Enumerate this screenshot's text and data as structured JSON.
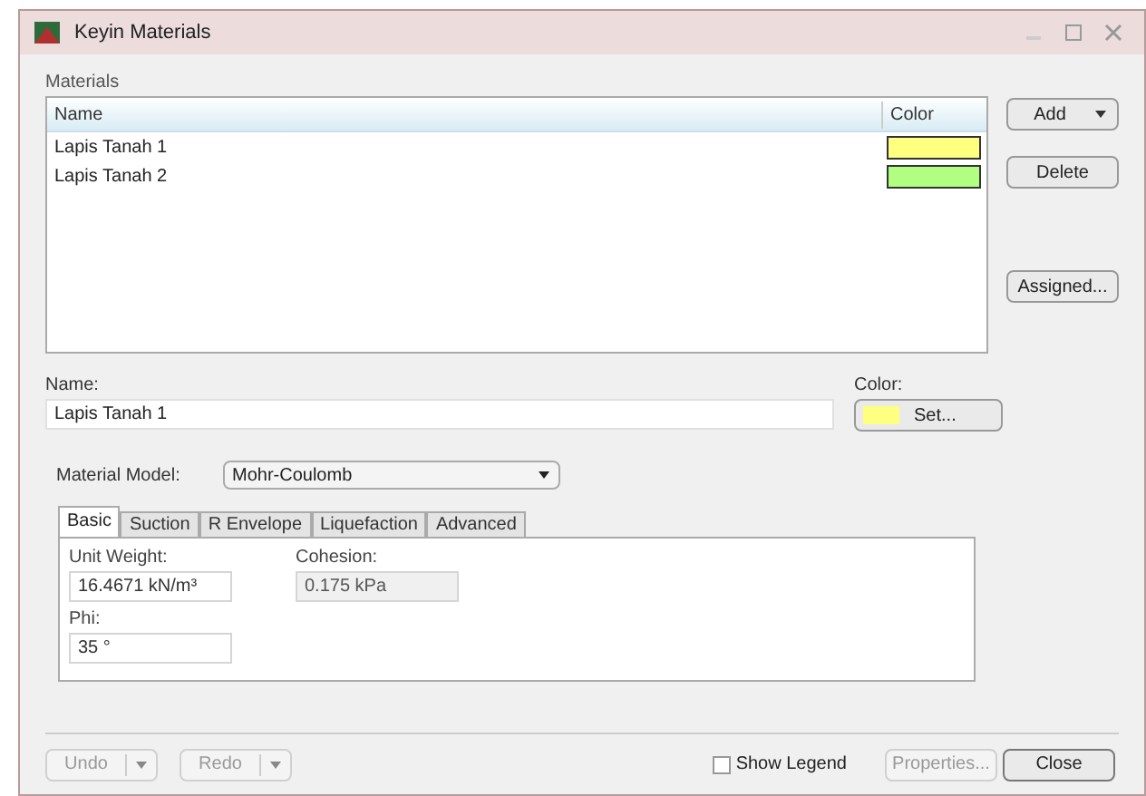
{
  "window": {
    "title": "Keyin Materials"
  },
  "materials": {
    "label": "Materials",
    "columns": [
      "Name",
      "Color"
    ],
    "rows": [
      {
        "name": "Lapis Tanah 1",
        "color": "#ffff80",
        "selected": false
      },
      {
        "name": "Lapis Tanah 2",
        "color": "#b0ff80",
        "selected": false
      }
    ]
  },
  "side_buttons": [
    {
      "label": "Add",
      "dropdown": true
    },
    {
      "label": "Delete",
      "dropdown": false
    },
    {
      "label": "Assigned...",
      "dropdown": false
    }
  ],
  "name_field": {
    "label": "Name:",
    "value": "Lapis Tanah 1"
  },
  "color_field": {
    "label": "Color:",
    "color": "#ffff80",
    "button": "Set..."
  },
  "material_model": {
    "label": "Material Model:",
    "value": "Mohr-Coulomb"
  },
  "tabs": [
    {
      "label": "Basic",
      "selected": true
    },
    {
      "label": "Suction",
      "selected": false
    },
    {
      "label": "R Envelope",
      "selected": false
    },
    {
      "label": "Liquefaction",
      "selected": false
    },
    {
      "label": "Advanced",
      "selected": false
    }
  ],
  "fields": [
    {
      "label": "Unit Weight:",
      "value": "16.4671 kN/m³",
      "disabled": false
    },
    {
      "label": "Cohesion:",
      "value": "0.175 kPa",
      "disabled": true
    },
    {
      "label": "Phi:",
      "value": "35 °",
      "disabled": false
    }
  ],
  "footer": {
    "undo": {
      "label": "Undo",
      "disabled": true
    },
    "redo": {
      "label": "Redo",
      "disabled": true
    },
    "show_legend": {
      "label": "Show Legend",
      "checked": false
    },
    "properties": {
      "label": "Properties...",
      "disabled": true
    },
    "close": {
      "label": "Close",
      "disabled": false
    }
  }
}
